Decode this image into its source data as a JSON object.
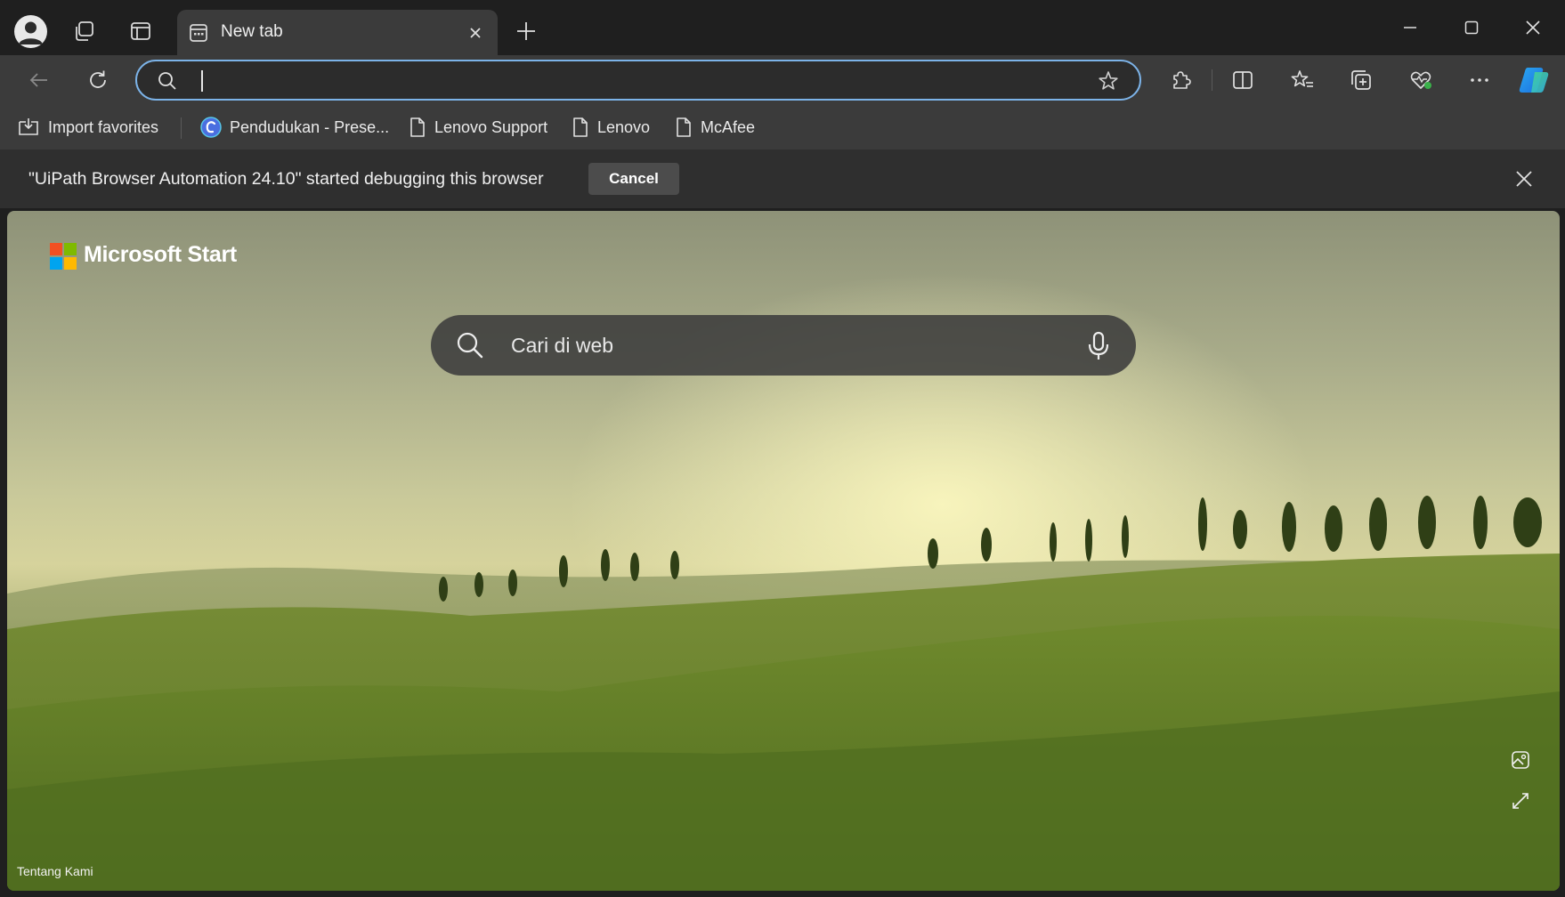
{
  "window": {
    "tab_title": "New tab"
  },
  "address_bar": {
    "value": "",
    "placeholder": ""
  },
  "favorites": [
    {
      "label": "Import favorites",
      "icon": "import-favorites-icon"
    },
    {
      "label": "Pendudukan - Prese...",
      "icon": "site-c-icon"
    },
    {
      "label": "Lenovo Support",
      "icon": "page-icon"
    },
    {
      "label": "Lenovo",
      "icon": "page-icon"
    },
    {
      "label": "McAfee",
      "icon": "page-icon"
    }
  ],
  "infobar": {
    "message": "\"UiPath Browser Automation 24.10\" started debugging this browser",
    "cancel_label": "Cancel"
  },
  "page": {
    "brand": "Microsoft Start",
    "search_placeholder": "Cari di web",
    "footer_link": "Tentang Kami"
  },
  "colors": {
    "accent_focus": "#7cb3e8",
    "toolbar_bg": "#3b3b3b",
    "titlebar_bg": "#1f1f1f",
    "ms_red": "#f25022",
    "ms_green": "#7fba00",
    "ms_blue": "#00a4ef",
    "ms_yellow": "#ffb900"
  }
}
